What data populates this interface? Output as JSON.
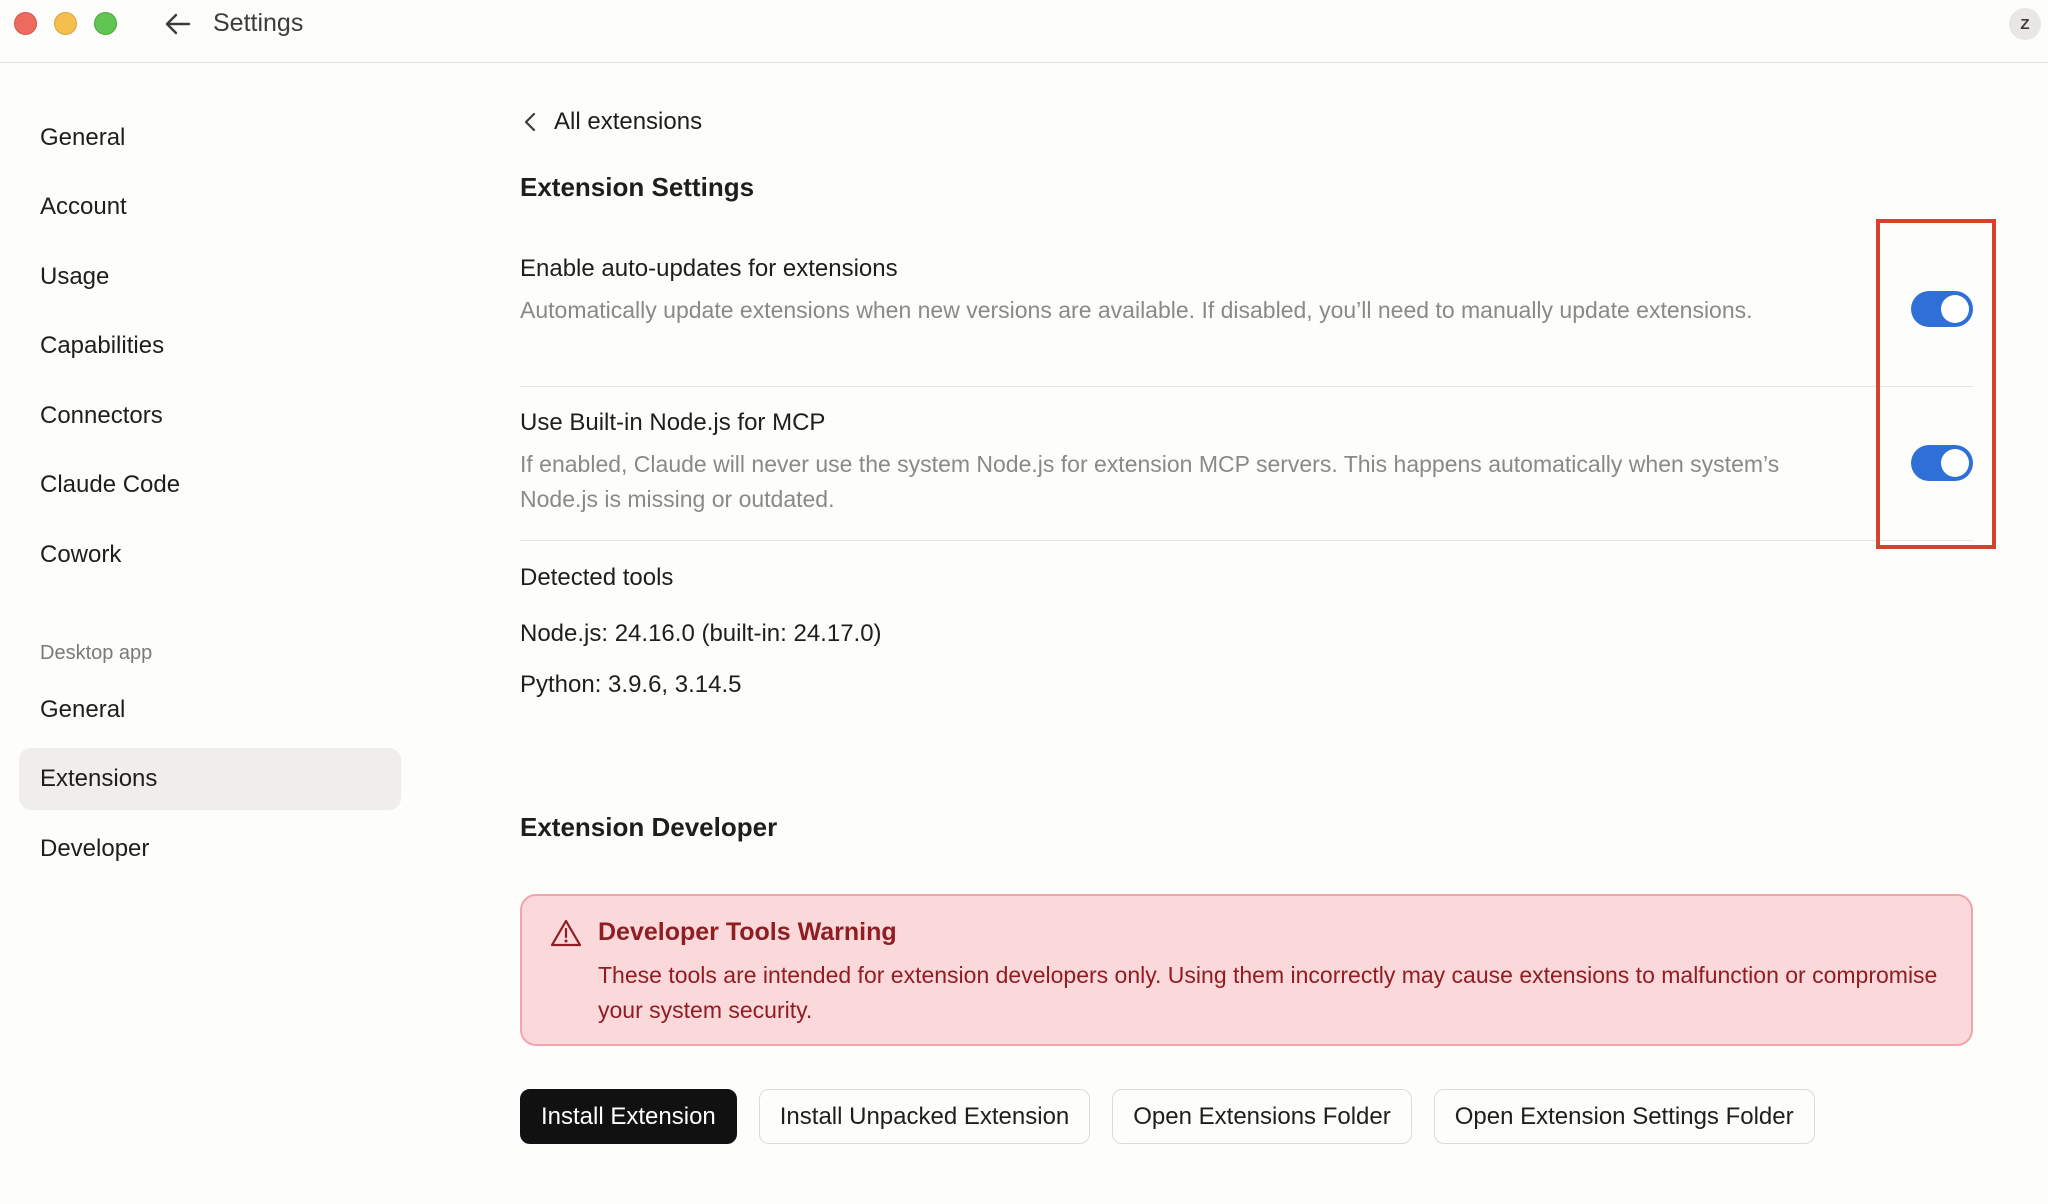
{
  "window": {
    "title": "Settings",
    "avatar_initial": "Z"
  },
  "sidebar": {
    "items": [
      {
        "label": "General"
      },
      {
        "label": "Account"
      },
      {
        "label": "Usage"
      },
      {
        "label": "Capabilities"
      },
      {
        "label": "Connectors"
      },
      {
        "label": "Claude Code"
      },
      {
        "label": "Cowork"
      }
    ],
    "section_label": "Desktop app",
    "desktop_items": [
      {
        "label": "General"
      },
      {
        "label": "Extensions",
        "active": true
      },
      {
        "label": "Developer"
      }
    ]
  },
  "main": {
    "breadcrumb": "All extensions",
    "extension_settings": {
      "title": "Extension Settings",
      "settings": [
        {
          "label": "Enable auto-updates for extensions",
          "description": "Automatically update extensions when new versions are available. If disabled, you’ll need to manually update extensions.",
          "enabled": true
        },
        {
          "label": "Use Built-in Node.js for MCP",
          "description": "If enabled, Claude will never use the system Node.js for extension MCP servers. This happens automatically when system’s Node.js is missing or outdated.",
          "enabled": true
        }
      ]
    },
    "detected_tools": {
      "title": "Detected tools",
      "node": "Node.js: 24.16.0 (built-in: 24.17.0)",
      "python": "Python: 3.9.6, 3.14.5"
    },
    "extension_developer": {
      "title": "Extension Developer",
      "warning_title": "Developer Tools Warning",
      "warning_body": "These tools are intended for extension developers only. Using them incorrectly may cause extensions to malfunction or compromise your system security."
    },
    "buttons": {
      "install": "Install Extension",
      "install_unpacked": "Install Unpacked Extension",
      "open_folder": "Open Extensions Folder",
      "open_settings_folder": "Open Extension Settings Folder"
    }
  },
  "colors": {
    "toggle_on": "#2f6fd8",
    "warning_bg": "#fbd9db",
    "warning_text": "#8f1d22",
    "highlight": "#d4432f"
  }
}
